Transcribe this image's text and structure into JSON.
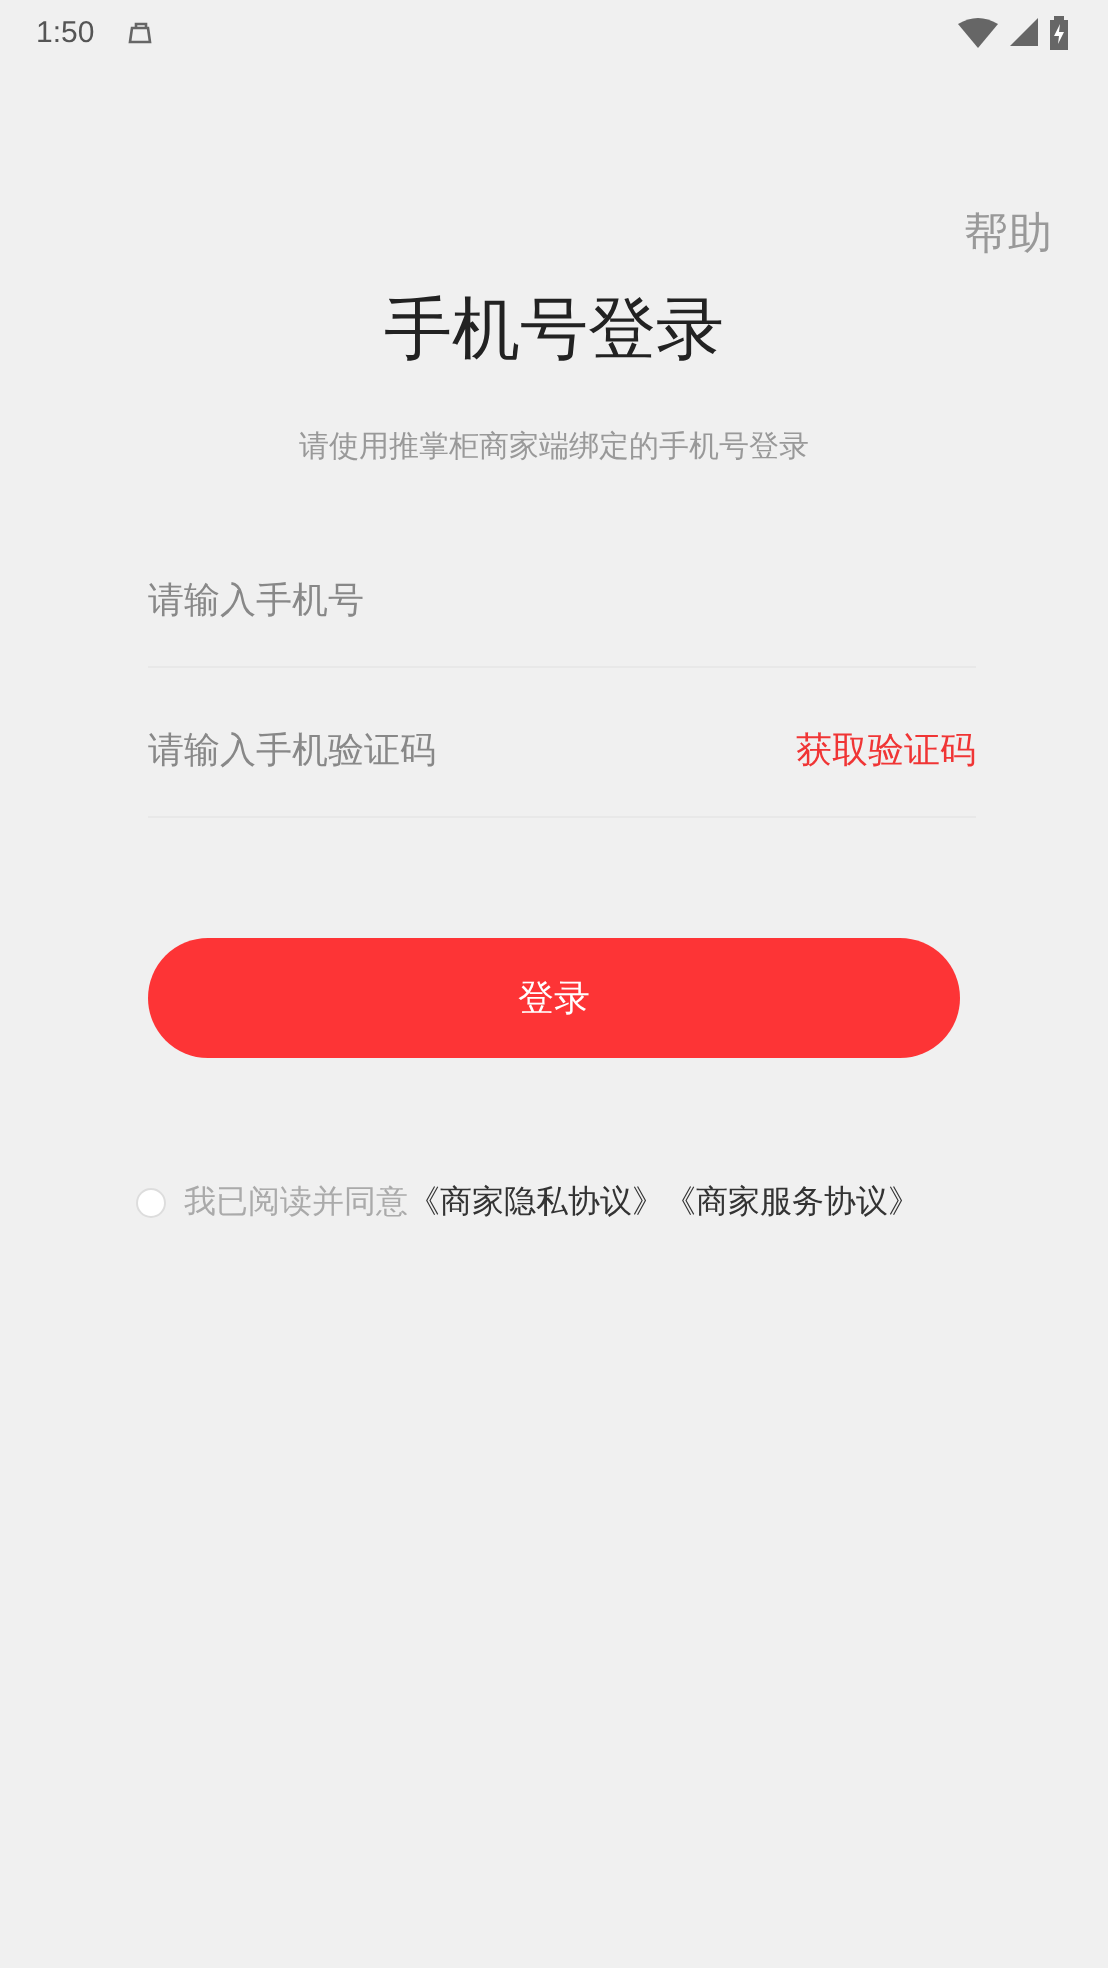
{
  "status_bar": {
    "time": "1:50"
  },
  "help": "帮助",
  "title": "手机号登录",
  "subtitle": "请使用推掌柜商家端绑定的手机号登录",
  "phone_field": {
    "placeholder": "请输入手机号"
  },
  "code_field": {
    "placeholder": "请输入手机验证码",
    "action": "获取验证码"
  },
  "login_button": "登录",
  "agreement": {
    "checked": false,
    "text": "我已阅读并同意",
    "links": [
      "《商家隐私协议》",
      "《商家服务协议》"
    ]
  }
}
